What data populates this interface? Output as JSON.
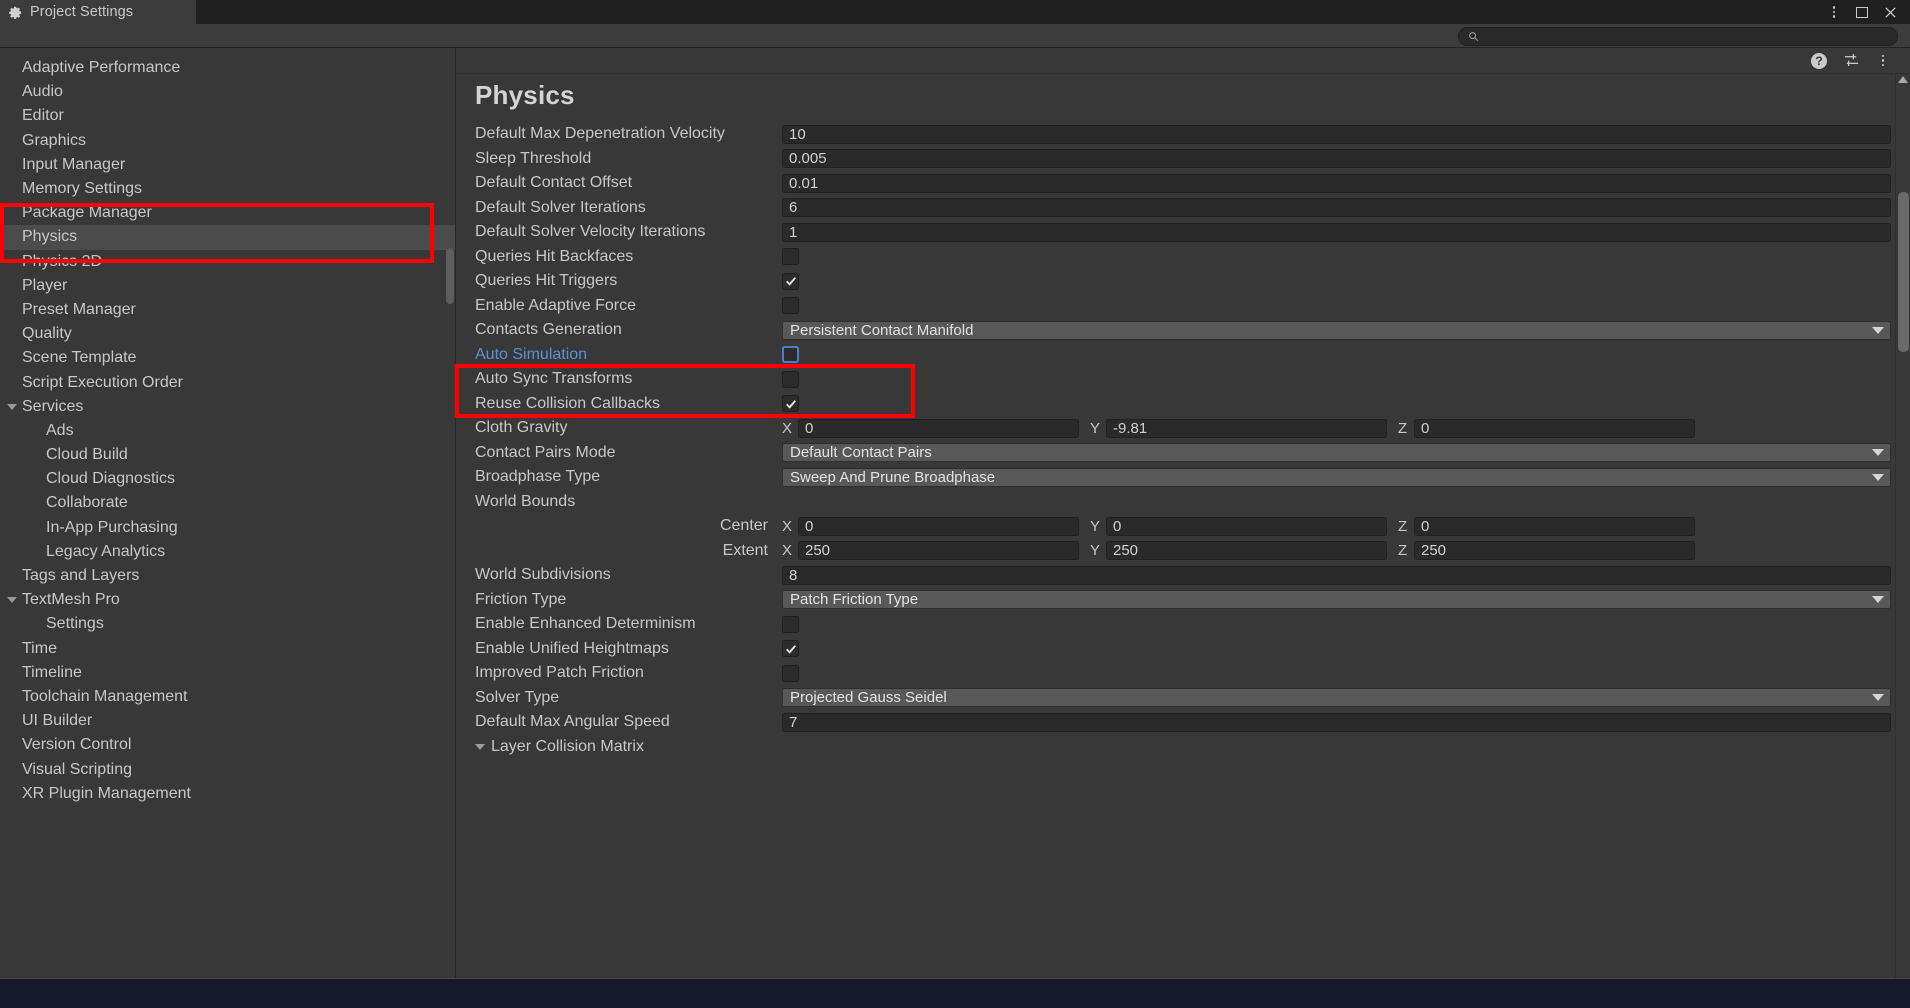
{
  "window": {
    "tab_title": "Project Settings",
    "tab_icon": "gear-icon",
    "controls": [
      {
        "name": "window-menu-button",
        "icon": "kebab-menu-icon"
      },
      {
        "name": "maximize-button",
        "icon": "maximize-icon"
      },
      {
        "name": "close-button",
        "icon": "close-icon",
        "glyph": "✕"
      }
    ]
  },
  "search": {
    "placeholder": "",
    "value": "",
    "icon": "search-icon"
  },
  "sidebar": {
    "items": [
      {
        "label": "Adaptive Performance",
        "indent": 0,
        "foldout": false,
        "selected": false
      },
      {
        "label": "Audio",
        "indent": 0,
        "foldout": false,
        "selected": false
      },
      {
        "label": "Editor",
        "indent": 0,
        "foldout": false,
        "selected": false
      },
      {
        "label": "Graphics",
        "indent": 0,
        "foldout": false,
        "selected": false
      },
      {
        "label": "Input Manager",
        "indent": 0,
        "foldout": false,
        "selected": false
      },
      {
        "label": "Memory Settings",
        "indent": 0,
        "foldout": false,
        "selected": false
      },
      {
        "label": "Package Manager",
        "indent": 0,
        "foldout": false,
        "selected": false
      },
      {
        "label": "Physics",
        "indent": 0,
        "foldout": false,
        "selected": true
      },
      {
        "label": "Physics 2D",
        "indent": 0,
        "foldout": false,
        "selected": false
      },
      {
        "label": "Player",
        "indent": 0,
        "foldout": false,
        "selected": false
      },
      {
        "label": "Preset Manager",
        "indent": 0,
        "foldout": false,
        "selected": false
      },
      {
        "label": "Quality",
        "indent": 0,
        "foldout": false,
        "selected": false
      },
      {
        "label": "Scene Template",
        "indent": 0,
        "foldout": false,
        "selected": false
      },
      {
        "label": "Script Execution Order",
        "indent": 0,
        "foldout": false,
        "selected": false
      },
      {
        "label": "Services",
        "indent": 0,
        "foldout": true,
        "selected": false
      },
      {
        "label": "Ads",
        "indent": 1,
        "foldout": false,
        "selected": false
      },
      {
        "label": "Cloud Build",
        "indent": 1,
        "foldout": false,
        "selected": false
      },
      {
        "label": "Cloud Diagnostics",
        "indent": 1,
        "foldout": false,
        "selected": false
      },
      {
        "label": "Collaborate",
        "indent": 1,
        "foldout": false,
        "selected": false
      },
      {
        "label": "In-App Purchasing",
        "indent": 1,
        "foldout": false,
        "selected": false
      },
      {
        "label": "Legacy Analytics",
        "indent": 1,
        "foldout": false,
        "selected": false
      },
      {
        "label": "Tags and Layers",
        "indent": 0,
        "foldout": false,
        "selected": false
      },
      {
        "label": "TextMesh Pro",
        "indent": 0,
        "foldout": true,
        "selected": false
      },
      {
        "label": "Settings",
        "indent": 1,
        "foldout": false,
        "selected": false
      },
      {
        "label": "Time",
        "indent": 0,
        "foldout": false,
        "selected": false
      },
      {
        "label": "Timeline",
        "indent": 0,
        "foldout": false,
        "selected": false
      },
      {
        "label": "Toolchain Management",
        "indent": 0,
        "foldout": false,
        "selected": false
      },
      {
        "label": "UI Builder",
        "indent": 0,
        "foldout": false,
        "selected": false
      },
      {
        "label": "Version Control",
        "indent": 0,
        "foldout": false,
        "selected": false
      },
      {
        "label": "Visual Scripting",
        "indent": 0,
        "foldout": false,
        "selected": false
      },
      {
        "label": "XR Plugin Management",
        "indent": 0,
        "foldout": false,
        "selected": false
      }
    ]
  },
  "panel": {
    "title": "Physics",
    "toolbar": [
      {
        "name": "help-button",
        "icon": "help-icon",
        "glyph": "?"
      },
      {
        "name": "preset-button",
        "icon": "sliders-icon"
      },
      {
        "name": "panel-menu-button",
        "icon": "kebab-menu-icon"
      }
    ],
    "properties": [
      {
        "type": "text",
        "label": "Default Max Depenetration Velocity",
        "value": "10"
      },
      {
        "type": "text",
        "label": "Sleep Threshold",
        "value": "0.005"
      },
      {
        "type": "text",
        "label": "Default Contact Offset",
        "value": "0.01"
      },
      {
        "type": "text",
        "label": "Default Solver Iterations",
        "value": "6"
      },
      {
        "type": "text",
        "label": "Default Solver Velocity Iterations",
        "value": "1"
      },
      {
        "type": "checkbox",
        "label": "Queries Hit Backfaces",
        "checked": false
      },
      {
        "type": "checkbox",
        "label": "Queries Hit Triggers",
        "checked": true
      },
      {
        "type": "checkbox",
        "label": "Enable Adaptive Force",
        "checked": false
      },
      {
        "type": "dropdown",
        "label": "Contacts Generation",
        "value": "Persistent Contact Manifold"
      },
      {
        "type": "checkbox",
        "label": "Auto Simulation",
        "checked": false,
        "highlight": true,
        "focused": true
      },
      {
        "type": "checkbox",
        "label": "Auto Sync Transforms",
        "checked": false,
        "highlight": true
      },
      {
        "type": "checkbox",
        "label": "Reuse Collision Callbacks",
        "checked": true
      },
      {
        "type": "vector3",
        "label": "Cloth Gravity",
        "x": "0",
        "y": "-9.81",
        "z": "0"
      },
      {
        "type": "dropdown",
        "label": "Contact Pairs Mode",
        "value": "Default Contact Pairs"
      },
      {
        "type": "dropdown",
        "label": "Broadphase Type",
        "value": "Sweep And Prune Broadphase"
      },
      {
        "type": "header",
        "label": "World Bounds"
      },
      {
        "type": "vector3",
        "label": "Center",
        "sublabel": true,
        "x": "0",
        "y": "0",
        "z": "0"
      },
      {
        "type": "vector3",
        "label": "Extent",
        "sublabel": true,
        "x": "250",
        "y": "250",
        "z": "250"
      },
      {
        "type": "text",
        "label": "World Subdivisions",
        "value": "8"
      },
      {
        "type": "dropdown",
        "label": "Friction Type",
        "value": "Patch Friction Type"
      },
      {
        "type": "checkbox",
        "label": "Enable Enhanced Determinism",
        "checked": false
      },
      {
        "type": "checkbox",
        "label": "Enable Unified Heightmaps",
        "checked": true
      },
      {
        "type": "checkbox",
        "label": "Improved Patch Friction",
        "checked": false
      },
      {
        "type": "dropdown",
        "label": "Solver Type",
        "value": "Projected Gauss Seidel"
      },
      {
        "type": "text",
        "label": "Default Max Angular Speed",
        "value": "7"
      },
      {
        "type": "foldout",
        "label": "Layer Collision Matrix",
        "expanded": true
      }
    ],
    "axis_labels": {
      "x": "X",
      "y": "Y",
      "z": "Z"
    }
  },
  "annotations": {
    "color": "#fe0000",
    "boxes": [
      {
        "name": "annotation-sidebar-physics",
        "target": "Physics"
      },
      {
        "name": "annotation-auto-simulation",
        "target": "Auto Simulation"
      }
    ]
  }
}
